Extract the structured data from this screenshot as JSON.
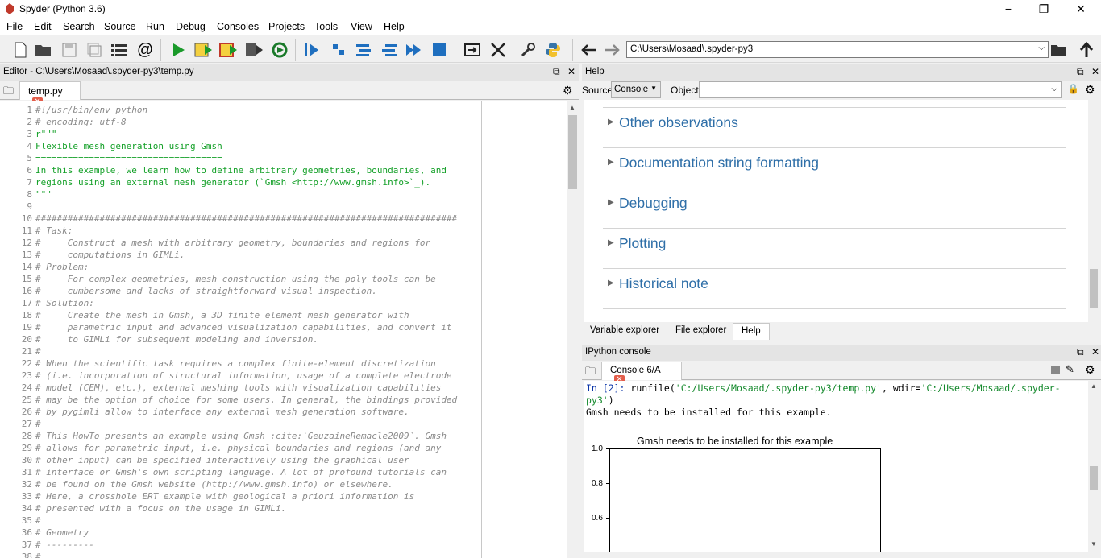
{
  "window": {
    "title": "Spyder (Python 3.6)",
    "minimize": "−",
    "maximize": "❐",
    "close": "✕"
  },
  "menu": [
    "File",
    "Edit",
    "Search",
    "Source",
    "Run",
    "Debug",
    "Consoles",
    "Projects",
    "Tools",
    "View",
    "Help"
  ],
  "toolbar": {
    "path": "C:\\Users\\Mosaad\\.spyder-py3"
  },
  "editor": {
    "title": "Editor - C:\\Users\\Mosaad\\.spyder-py3\\temp.py",
    "tab": "temp.py",
    "lines": [
      {
        "n": "1",
        "t": "#!/usr/bin/env python",
        "c": "comment"
      },
      {
        "n": "2",
        "t": "# encoding: utf-8",
        "c": "comment"
      },
      {
        "n": "3",
        "t": "r\"\"\"",
        "c": "string"
      },
      {
        "n": "4",
        "t": "Flexible mesh generation using Gmsh",
        "c": "string"
      },
      {
        "n": "5",
        "t": "===================================",
        "c": "string"
      },
      {
        "n": "6",
        "t": "In this example, we learn how to define arbitrary geometries, boundaries, and",
        "c": "string"
      },
      {
        "n": "7",
        "t": "regions using an external mesh generator (`Gmsh <http://www.gmsh.info>`_).",
        "c": "string"
      },
      {
        "n": "8",
        "t": "\"\"\"",
        "c": "string"
      },
      {
        "n": "9",
        "t": "",
        "c": "code"
      },
      {
        "n": "10",
        "t": "###############################################################################",
        "c": "comment"
      },
      {
        "n": "11",
        "t": "# Task:",
        "c": "comment"
      },
      {
        "n": "12",
        "t": "#     Construct a mesh with arbitrary geometry, boundaries and regions for",
        "c": "comment"
      },
      {
        "n": "13",
        "t": "#     computations in GIMLi.",
        "c": "comment"
      },
      {
        "n": "14",
        "t": "# Problem:",
        "c": "comment"
      },
      {
        "n": "15",
        "t": "#     For complex geometries, mesh construction using the poly tools can be",
        "c": "comment"
      },
      {
        "n": "16",
        "t": "#     cumbersome and lacks of straightforward visual inspection.",
        "c": "comment"
      },
      {
        "n": "17",
        "t": "# Solution:",
        "c": "comment"
      },
      {
        "n": "18",
        "t": "#     Create the mesh in Gmsh, a 3D finite element mesh generator with",
        "c": "comment"
      },
      {
        "n": "19",
        "t": "#     parametric input and advanced visualization capabilities, and convert it",
        "c": "comment"
      },
      {
        "n": "20",
        "t": "#     to GIMLi for subsequent modeling and inversion.",
        "c": "comment"
      },
      {
        "n": "21",
        "t": "#",
        "c": "comment"
      },
      {
        "n": "22",
        "t": "# When the scientific task requires a complex finite-element discretization",
        "c": "comment"
      },
      {
        "n": "23",
        "t": "# (i.e. incorporation of structural information, usage of a complete electrode",
        "c": "comment"
      },
      {
        "n": "24",
        "t": "# model (CEM), etc.), external meshing tools with visualization capabilities",
        "c": "comment"
      },
      {
        "n": "25",
        "t": "# may be the option of choice for some users. In general, the bindings provided",
        "c": "comment"
      },
      {
        "n": "26",
        "t": "# by pygimli allow to interface any external mesh generation software.",
        "c": "comment"
      },
      {
        "n": "27",
        "t": "#",
        "c": "comment"
      },
      {
        "n": "28",
        "t": "# This HowTo presents an example using Gmsh :cite:`GeuzaineRemacle2009`. Gmsh",
        "c": "comment"
      },
      {
        "n": "29",
        "t": "# allows for parametric input, i.e. physical boundaries and regions (and any",
        "c": "comment"
      },
      {
        "n": "30",
        "t": "# other input) can be specified interactively using the graphical user",
        "c": "comment"
      },
      {
        "n": "31",
        "t": "# interface or Gmsh's own scripting language. A lot of profound tutorials can",
        "c": "comment"
      },
      {
        "n": "32",
        "t": "# be found on the Gmsh website (http://www.gmsh.info) or elsewhere.",
        "c": "comment"
      },
      {
        "n": "33",
        "t": "# Here, a crosshole ERT example with geological a priori information is",
        "c": "comment"
      },
      {
        "n": "34",
        "t": "# presented with a focus on the usage in GIMLi.",
        "c": "comment"
      },
      {
        "n": "35",
        "t": "#",
        "c": "comment"
      },
      {
        "n": "36",
        "t": "# Geometry",
        "c": "comment"
      },
      {
        "n": "37",
        "t": "# ---------",
        "c": "comment"
      },
      {
        "n": "38",
        "t": "#",
        "c": "comment"
      }
    ]
  },
  "help": {
    "title": "Help",
    "source_label": "Source",
    "source_value": "Console",
    "object_label": "Object",
    "items": [
      "Other observations",
      "Documentation string formatting",
      "Debugging",
      "Plotting",
      "Historical note"
    ],
    "tabs": [
      "Variable explorer",
      "File explorer",
      "Help"
    ]
  },
  "console": {
    "title": "IPython console",
    "tab": "Console 6/A",
    "prompt": "In [2]: ",
    "call_a": "runfile(",
    "arg1": "'C:/Users/Mosaad/.spyder-py3/temp.py'",
    "call_b": ", wdir=",
    "arg2_a": "'C:/Users/Mosaad/.spyder-",
    "arg2_b": "py3'",
    "call_c": ")",
    "output": "Gmsh needs to be installed for this example.",
    "plot_title": "Gmsh needs to be installed for this example",
    "yticks": [
      "1.0",
      "0.8",
      "0.6"
    ]
  },
  "colors": {
    "comment": "#8a8a8a",
    "string": "#14a028",
    "code": "#000000",
    "link": "#2f6fa8",
    "accent_green": "#14892c"
  }
}
